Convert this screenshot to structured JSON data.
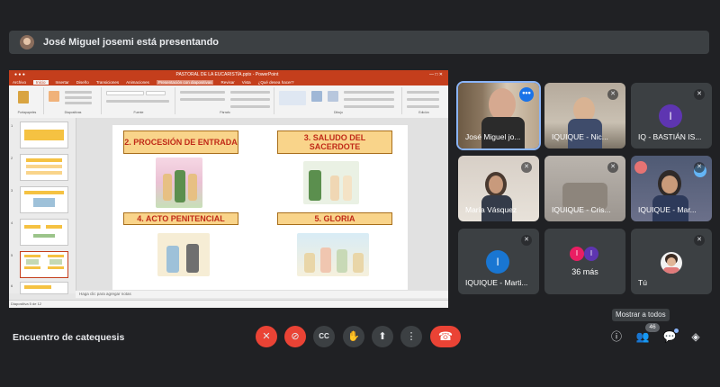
{
  "presenter_banner": {
    "text": "José Miguel josemi está presentando"
  },
  "ppt": {
    "window_title": "PASTORAL DE LA EUCARISTÍA.pptx - PowerPoint",
    "tabs": [
      "Archivo",
      "Inicio",
      "Insertar",
      "Diseño",
      "Transiciones",
      "Animaciones",
      "Presentación con diapositivas",
      "Revisar",
      "Vista",
      "¿Qué desea hacer?"
    ],
    "ribbon_groups": [
      "Portapapeles",
      "Diapositivas",
      "Fuente",
      "Párrafo",
      "Dibujo",
      "Edición"
    ],
    "slide_boxes": [
      "2. PROCESIÓN DE ENTRADA",
      "3. SALUDO DEL SACERDOTE",
      "4. ACTO PENITENCIAL",
      "5. GLORIA"
    ],
    "notes_placeholder": "Haga clic para agregar notas",
    "status_left": "Diapositiva 5 de 12",
    "thumb_numbers": [
      "1",
      "2",
      "3",
      "4",
      "5",
      "6"
    ]
  },
  "participants": [
    {
      "name": "José Miguel jo...",
      "type": "video"
    },
    {
      "name": "IQUIQUE - Nic...",
      "type": "video",
      "muted": true
    },
    {
      "name": "IQ - BASTIÁN IS...",
      "type": "avatar",
      "letter": "I",
      "color": "#5e35b1",
      "muted": true
    },
    {
      "name": "María Vásquez",
      "type": "video",
      "muted": true
    },
    {
      "name": "IQUIQUE - Cris...",
      "type": "video",
      "muted": true
    },
    {
      "name": "IQUIQUE - Mar...",
      "type": "video",
      "muted": true
    },
    {
      "name": "IQUIQUE - Marti...",
      "type": "avatar",
      "letter": "I",
      "color": "#1976d2",
      "muted": true
    },
    {
      "name": "36 más",
      "type": "group",
      "letters": [
        "I",
        "I"
      ],
      "colors": [
        "#e91e63",
        "#5e35b1"
      ]
    },
    {
      "name": "Tú",
      "type": "self",
      "muted": true
    }
  ],
  "bottom": {
    "meeting_name": "Encuentro de catequesis",
    "tooltip": "Mostrar a todos",
    "people_count": "46"
  },
  "icons": {
    "mic_off": "🎙",
    "cam_off": "⊘",
    "captions": "CC",
    "hand": "✋",
    "present": "⬆",
    "more": "⋮",
    "hangup": "☎",
    "info": "ⓘ",
    "people": "👥",
    "chat": "💬",
    "activities": "◈",
    "mic_off_small": "✕"
  }
}
